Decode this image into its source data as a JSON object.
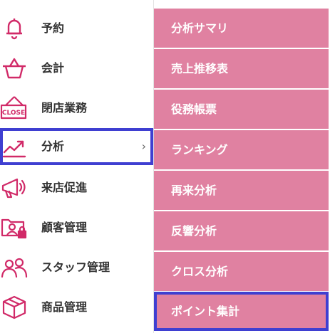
{
  "colors": {
    "accent_pink": "#e081a1",
    "icon_pink": "#d12a68",
    "highlight_blue": "#3f3fd1",
    "label_text": "#333333"
  },
  "left_menu": {
    "items": [
      {
        "label": "予約",
        "icon": "bell-icon"
      },
      {
        "label": "会計",
        "icon": "basket-icon"
      },
      {
        "label": "閉店業務",
        "icon": "close-sign-icon",
        "icon_text": "CLOSE"
      },
      {
        "label": "分析",
        "icon": "chart-trend-icon",
        "chevron": "›",
        "selected": true
      },
      {
        "label": "来店促進",
        "icon": "megaphone-icon"
      },
      {
        "label": "顧客管理",
        "icon": "customer-card-icon"
      },
      {
        "label": "スタッフ管理",
        "icon": "staff-icon"
      },
      {
        "label": "商品管理",
        "icon": "box-icon"
      }
    ]
  },
  "submenu": {
    "items": [
      {
        "label": "分析サマリ"
      },
      {
        "label": "売上推移表"
      },
      {
        "label": "役務帳票"
      },
      {
        "label": "ランキング"
      },
      {
        "label": "再来分析"
      },
      {
        "label": "反響分析"
      },
      {
        "label": "クロス分析"
      },
      {
        "label": "ポイント集計",
        "highlighted": true
      }
    ]
  }
}
